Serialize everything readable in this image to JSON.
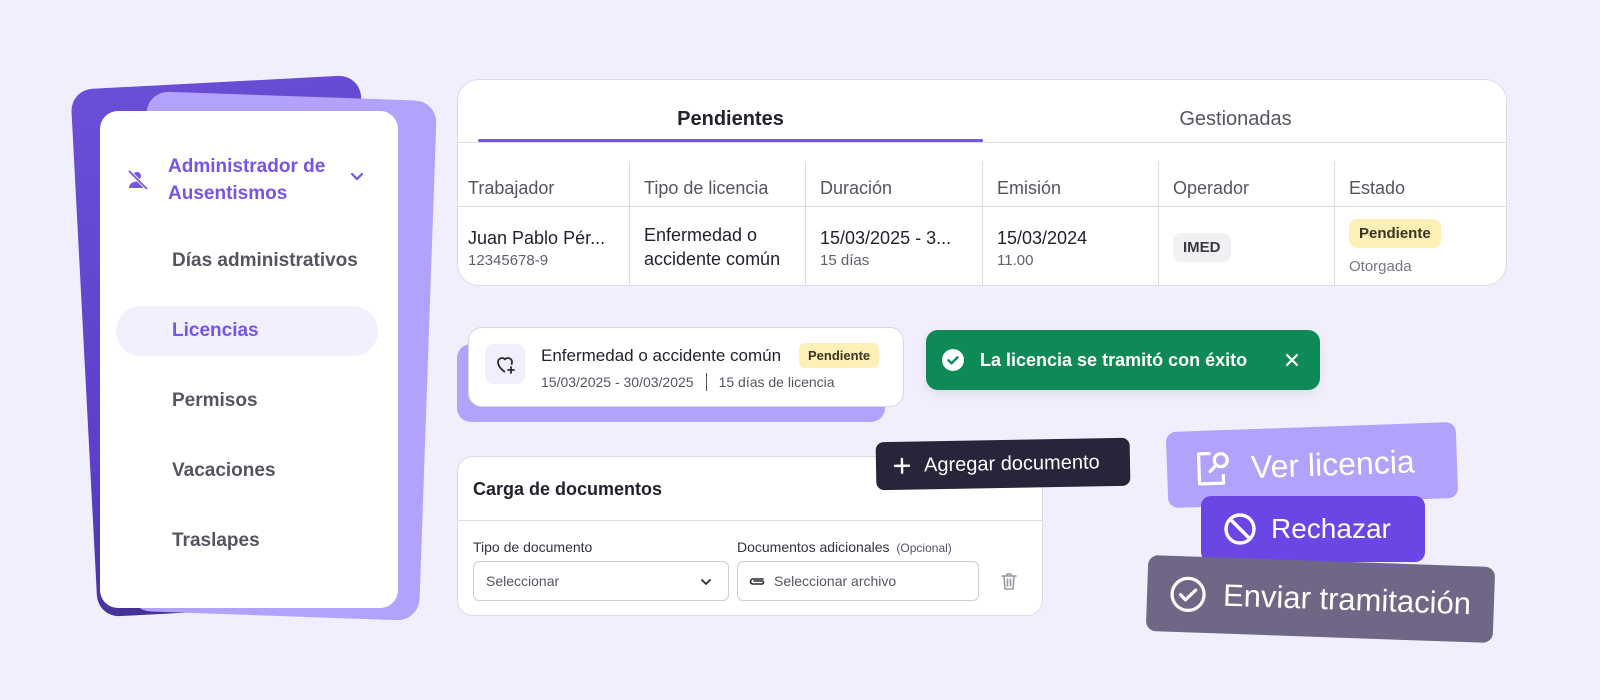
{
  "sidebar": {
    "title": "Administrador de Ausentismos",
    "items": [
      {
        "label": "Días administrativos",
        "active": false
      },
      {
        "label": "Licencias",
        "active": true
      },
      {
        "label": "Permisos",
        "active": false
      },
      {
        "label": "Vacaciones",
        "active": false
      },
      {
        "label": "Traslapes",
        "active": false
      }
    ]
  },
  "table": {
    "tabs": [
      {
        "label": "Pendientes",
        "active": true
      },
      {
        "label": "Gestionadas",
        "active": false
      }
    ],
    "columns": [
      "Trabajador",
      "Tipo de licencia",
      "Duración",
      "Emisión",
      "Operador",
      "Estado"
    ],
    "row": {
      "worker_name": "Juan Pablo Pér...",
      "worker_id": "12345678-9",
      "license_type": "Enfermedad o accidente común",
      "duration_range": "15/03/2025 - 3...",
      "duration_days": "15 días",
      "issue_date": "15/03/2024",
      "issue_time": "11.00",
      "operator": "IMED",
      "status": "Pendiente",
      "status_sub": "Otorgada"
    }
  },
  "license_card": {
    "title": "Enfermedad o accidente común",
    "badge": "Pendiente",
    "dates": "15/03/2025 - 30/03/2025",
    "days": "15 días de licencia"
  },
  "toast": {
    "message": "La licencia se tramitó con éxito",
    "color": "#0d8a55"
  },
  "documents": {
    "title": "Carga de documentos",
    "doc_type_label": "Tipo de documento",
    "doc_type_value": "Seleccionar",
    "additional_label": "Documentos adicionales",
    "additional_optional": "(Opcional)",
    "file_placeholder": "Seleccionar archivo"
  },
  "buttons": {
    "add_document": "Agregar documento",
    "view_license": "Ver licencia",
    "reject": "Rechazar",
    "send": "Enviar tramitación"
  },
  "colors": {
    "accent": "#7653ea",
    "accent_light": "#b3a2fb",
    "reject": "#6c46e4",
    "send": "#6f6785",
    "dark": "#26253a",
    "pending_bg": "#fdf0b6"
  }
}
